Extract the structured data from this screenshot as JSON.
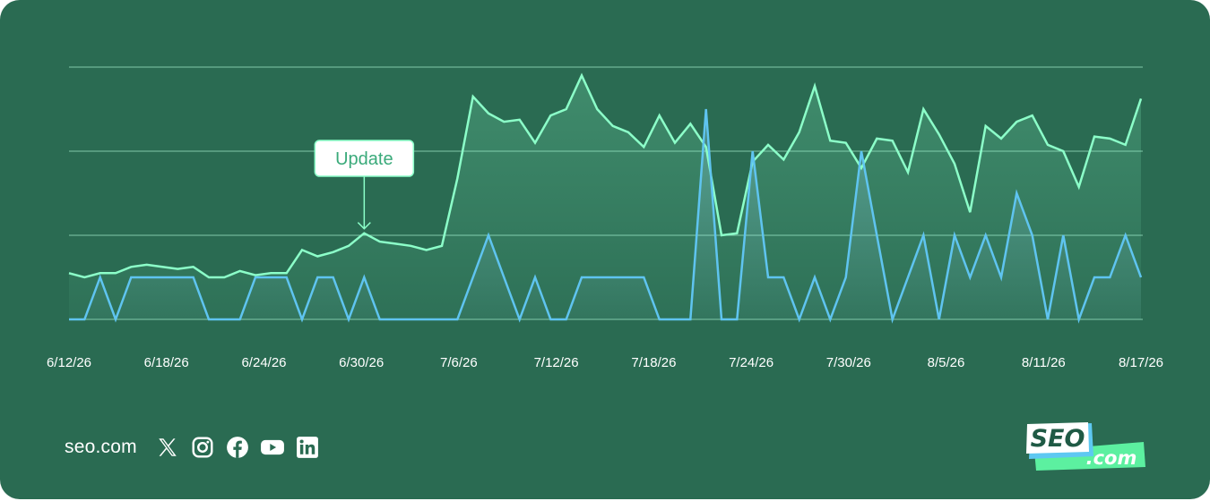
{
  "colors": {
    "background": "#2a6b52",
    "gridline": "#9fe8c8",
    "series_primary": "#8cffc9",
    "series_secondary": "#5fc4f0",
    "annotation_bg": "#ffffff",
    "annotation_text": "#3aaa7a",
    "logo_white": "#ffffff",
    "logo_green": "#5cf0a0",
    "logo_blue": "#5ec8f2"
  },
  "chart_data": {
    "type": "area",
    "x_ticks": [
      "6/12/26",
      "6/18/26",
      "6/24/26",
      "6/30/26",
      "7/6/26",
      "7/12/26",
      "7/18/26",
      "7/24/26",
      "7/30/26",
      "8/5/26",
      "8/11/26",
      "8/17/26"
    ],
    "x_start": "6/12/26",
    "x_end": "8/17/26",
    "ylim": [
      0,
      6
    ],
    "grid": true,
    "y_tick_labels_shown": false,
    "series": [
      {
        "role": "primary",
        "values": [
          1.1,
          1.0,
          1.1,
          1.1,
          1.25,
          1.3,
          1.25,
          1.2,
          1.25,
          1.0,
          1.0,
          1.15,
          1.05,
          1.1,
          1.1,
          1.65,
          1.5,
          1.6,
          1.75,
          2.05,
          1.85,
          1.8,
          1.75,
          1.65,
          1.75,
          3.35,
          5.3,
          4.9,
          4.7,
          4.75,
          4.2,
          4.85,
          5.0,
          5.8,
          5.0,
          4.6,
          4.45,
          4.1,
          4.85,
          4.2,
          4.65,
          4.1,
          2.0,
          2.05,
          3.75,
          4.15,
          3.8,
          4.45,
          5.55,
          4.25,
          4.2,
          3.6,
          4.3,
          4.25,
          3.5,
          5.0,
          4.4,
          3.7,
          2.55,
          4.6,
          4.3,
          4.7,
          4.85,
          4.15,
          4.0,
          3.15,
          4.35,
          4.3,
          4.15,
          5.25
        ]
      },
      {
        "role": "secondary",
        "values": [
          0,
          0,
          1,
          0,
          1,
          1,
          1,
          1,
          1,
          0,
          0,
          0,
          1,
          1,
          1,
          0,
          1,
          1,
          0,
          1,
          0,
          0,
          0,
          0,
          0,
          0,
          1,
          2,
          1,
          0,
          1,
          0,
          0,
          1,
          1,
          1,
          1,
          1,
          0,
          0,
          0,
          5,
          0,
          0,
          4,
          1,
          1,
          0,
          1,
          0,
          1,
          4,
          2,
          0,
          1,
          2,
          0,
          2,
          1,
          2,
          1,
          3,
          2,
          0,
          2,
          0,
          1,
          1,
          2,
          1
        ]
      }
    ],
    "annotations": [
      {
        "label": "Update",
        "x_index": 19
      }
    ]
  },
  "footer": {
    "site": "seo.com",
    "social_icons": [
      "x-icon",
      "instagram-icon",
      "facebook-icon",
      "youtube-icon",
      "linkedin-icon"
    ]
  },
  "logo": {
    "line1": "SEO",
    "line2": ".com"
  }
}
